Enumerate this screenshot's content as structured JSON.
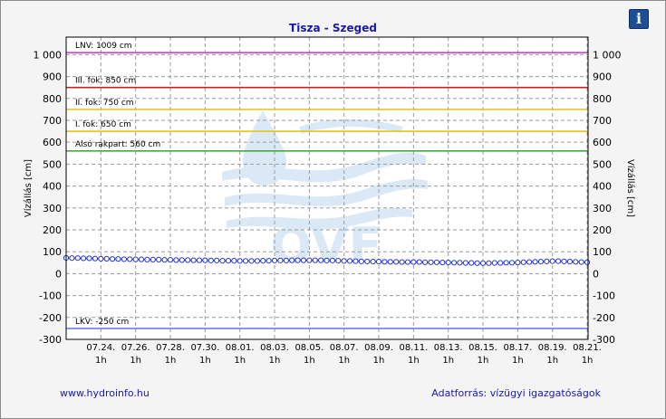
{
  "header": {
    "info_icon": "info-icon",
    "info_label": "i"
  },
  "footer": {
    "left_link": "www.hydroinfo.hu",
    "right_text": "Adatforrás: vízügyi igazgatóságok"
  },
  "watermark": {
    "text": "OVF"
  },
  "colors": {
    "title": "#1a1aa8",
    "series": "#2233dd",
    "lnv": "#cc44cc",
    "fok3": "#cc2222",
    "fok2": "#e8c21a",
    "fok1": "#e8c21a",
    "rakpart": "#44aa44",
    "lkv": "#7777ff"
  },
  "chart_data": {
    "type": "line",
    "title": "Tisza - Szeged",
    "ylabel": "Vízállás [cm]",
    "ylabel_right": "Vízállás [cm]",
    "ylim": [
      -300,
      1080
    ],
    "y_ticks": [
      -300,
      -200,
      -100,
      0,
      100,
      200,
      300,
      400,
      500,
      600,
      700,
      800,
      900,
      1000
    ],
    "y_tick_labels": [
      "-300",
      "-200",
      "-100",
      "0",
      "100",
      "200",
      "300",
      "400",
      "500",
      "600",
      "700",
      "800",
      "900",
      "1 000"
    ],
    "x_ticks": [
      "07.24.",
      "07.26.",
      "07.28.",
      "07.30.",
      "08.01.",
      "08.03.",
      "08.05.",
      "08.07.",
      "08.09.",
      "08.11.",
      "08.13.",
      "08.15.",
      "08.17.",
      "08.19.",
      "08.21."
    ],
    "x_tick_sublabel": "1h",
    "x_start": "07.22.",
    "x_end": "08.21.",
    "grid": true,
    "reference_lines": [
      {
        "label": "LNV: 1009 cm",
        "value": 1009,
        "color": "#cc44cc"
      },
      {
        "label": "III. fok: 850 cm",
        "value": 850,
        "color": "#cc2222"
      },
      {
        "label": "II. fok: 750 cm",
        "value": 750,
        "color": "#e8c21a"
      },
      {
        "label": "I. fok: 650 cm",
        "value": 650,
        "color": "#e8c21a"
      },
      {
        "label": "Alsó rakpart: 560 cm",
        "value": 560,
        "color": "#44aa44"
      },
      {
        "label": "LKV: -250 cm",
        "value": -250,
        "color": "#7777ff"
      }
    ],
    "series": [
      {
        "x_range": [
          "07.22.",
          "08.21."
        ],
        "values": [
          72,
          71,
          71,
          70,
          70,
          69,
          68,
          68,
          67,
          67,
          66,
          66,
          65,
          65,
          64,
          64,
          64,
          63,
          63,
          62,
          62,
          62,
          61,
          61,
          61,
          60,
          60,
          59,
          59,
          59,
          58,
          58,
          58,
          58,
          59,
          59,
          60,
          60,
          60,
          61,
          61,
          61,
          61,
          61,
          61,
          60,
          60,
          59,
          58,
          58,
          57,
          56,
          56,
          55,
          55,
          54,
          54,
          54,
          53,
          53,
          53,
          53,
          52,
          52,
          52,
          51,
          51,
          50,
          50,
          49,
          49,
          48,
          48,
          48,
          49,
          49,
          50,
          50,
          51,
          52,
          53,
          54,
          55,
          56,
          57,
          57,
          56,
          55,
          54,
          53,
          52
        ]
      }
    ]
  }
}
